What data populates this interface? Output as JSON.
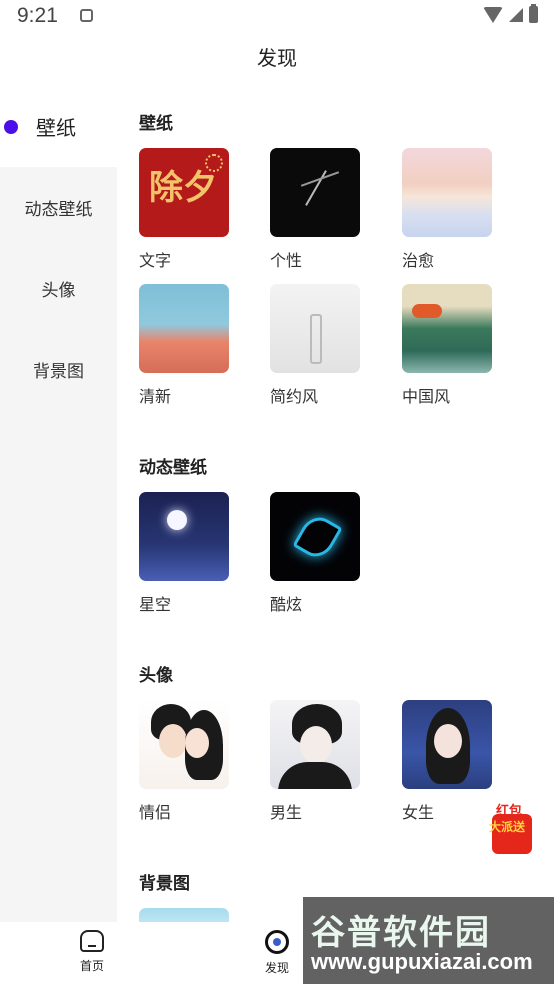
{
  "status_bar": {
    "time": "9:21"
  },
  "page_title": "发现",
  "sidebar": {
    "items": [
      {
        "label": "壁纸",
        "active": true
      },
      {
        "label": "动态壁纸",
        "active": false
      },
      {
        "label": "头像",
        "active": false
      },
      {
        "label": "背景图",
        "active": false
      }
    ]
  },
  "sections": {
    "wallpaper": {
      "title": "壁纸",
      "tiles": [
        "文字",
        "个性",
        "治愈",
        "清新",
        "简约风",
        "中国风"
      ]
    },
    "live": {
      "title": "动态壁纸",
      "tiles": [
        "星空",
        "酷炫"
      ]
    },
    "avatar": {
      "title": "头像",
      "tiles": [
        "情侣",
        "男生",
        "女生"
      ]
    },
    "background": {
      "title": "背景图"
    }
  },
  "thumb_text": {
    "wenzi": "除夕"
  },
  "promo": {
    "line1": "红包",
    "line2": "大派送"
  },
  "bottom_nav": {
    "items": [
      {
        "label": "首页",
        "icon": "home-icon"
      },
      {
        "label": "发现",
        "icon": "discover-icon"
      }
    ]
  },
  "watermark": {
    "line1": "谷普软件园",
    "line2": "www.gupuxiazai.com"
  },
  "colors": {
    "accent": "#4b0fe8",
    "sidebar_bg": "#f5f5f5"
  }
}
